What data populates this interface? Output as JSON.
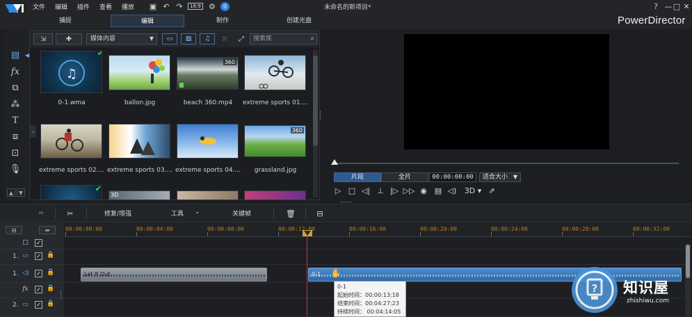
{
  "menu": [
    "文件",
    "编辑",
    "插件",
    "查看",
    "播放"
  ],
  "doc_title": "未命名的新项目*",
  "aspect_ratio": "16:9",
  "notification_count": "0",
  "window": {
    "help": "?",
    "minimize": "—",
    "maximize": "□",
    "close": "✕"
  },
  "tabs": [
    {
      "label": "捕捉",
      "active": false
    },
    {
      "label": "编辑",
      "active": true
    },
    {
      "label": "制作",
      "active": false
    },
    {
      "label": "创建光盘",
      "active": false
    }
  ],
  "brand": "PowerDirector",
  "library": {
    "media_filter": "媒体内容",
    "search_placeholder": "搜索库",
    "items": [
      {
        "label": "0-1.wma",
        "kind": "audio",
        "checked": true,
        "is360": false
      },
      {
        "label": "ballon.jpg",
        "kind": "image",
        "checked": false,
        "is360": false
      },
      {
        "label": "beach 360.mp4",
        "kind": "video",
        "checked": false,
        "is360": true
      },
      {
        "label": "extreme sports 01....",
        "kind": "image",
        "checked": false,
        "is360": false
      },
      {
        "label": "extreme sports 02....",
        "kind": "image",
        "checked": false,
        "is360": false
      },
      {
        "label": "extreme sports 03....",
        "kind": "image",
        "checked": false,
        "is360": false
      },
      {
        "label": "extreme sports 04....",
        "kind": "image",
        "checked": false,
        "is360": false
      },
      {
        "label": "grassland.jpg",
        "kind": "image",
        "checked": false,
        "is360": true
      }
    ],
    "partial_badges": [
      "3D"
    ]
  },
  "preview": {
    "segment_clip": "片段",
    "segment_full": "全片",
    "timecode": "00:00:00:00",
    "fit": "适合大小",
    "mode_3d": "3D"
  },
  "edit_toolbar": {
    "fix_enhance": "修复/增强",
    "tools": "工具",
    "keyframe": "关键帧"
  },
  "ruler_ticks": [
    "00:00:00:00",
    "00:00:04:00",
    "00:00:08:00",
    "00:00:12:00",
    "00:00:16:00",
    "00:00:20:00",
    "00:00:24:00",
    "00:00:28:00",
    "00:00:32:00"
  ],
  "tracks": [
    {
      "num": "",
      "type": "video"
    },
    {
      "num": "1.",
      "type": "video"
    },
    {
      "num": "1.",
      "type": "audio"
    },
    {
      "num": "",
      "type": "fx"
    },
    {
      "num": "2.",
      "type": "video"
    }
  ],
  "clips": {
    "a_label": "Let It Out",
    "b_label": "0-1"
  },
  "tooltip": {
    "title": "0-1",
    "start": "起始时间：00:00:13:18",
    "end": "结束时间：00:04:27:23",
    "duration": "持续时间： 00:04:14:05"
  },
  "watermark": {
    "cn": "知识屋",
    "en": "zhishiwu.com"
  },
  "colors": {
    "accent": "#3f5c86",
    "clip_audio": "#2f6aa6",
    "playhead": "#c8383c",
    "ruler_text": "#b07f2c"
  }
}
